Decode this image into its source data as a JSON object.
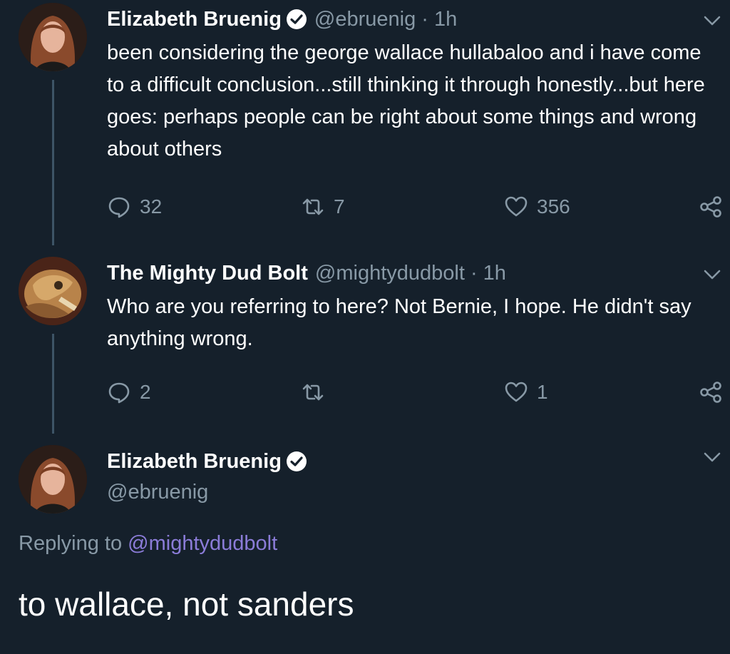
{
  "tweets": [
    {
      "name": "Elizabeth Bruenig",
      "verified": true,
      "handle_time": "@ebruenig · 1h",
      "text": "been considering the george wallace hullabaloo and i have come to a difficult conclusion...still thinking it through honestly...but here goes: perhaps people can be right about some things and wrong about others",
      "replies": "32",
      "retweets": "7",
      "likes": "356"
    },
    {
      "name": "The Mighty Dud Bolt",
      "verified": false,
      "handle_time": "@mightydudbolt · 1h",
      "text": "Who are you referring to here? Not Bernie, I hope. He didn't say anything wrong.",
      "replies": "2",
      "retweets": "",
      "likes": "1"
    }
  ],
  "main_tweet": {
    "name": "Elizabeth Bruenig",
    "handle": "@ebruenig",
    "replying_prefix": "Replying to",
    "replying_handle": "@mightydudbolt",
    "text": "to wallace, not sanders"
  },
  "colors": {
    "background": "#15202b",
    "secondary_text": "#8899a6",
    "link": "#8b7cd8",
    "thread_line": "#3d5466"
  }
}
